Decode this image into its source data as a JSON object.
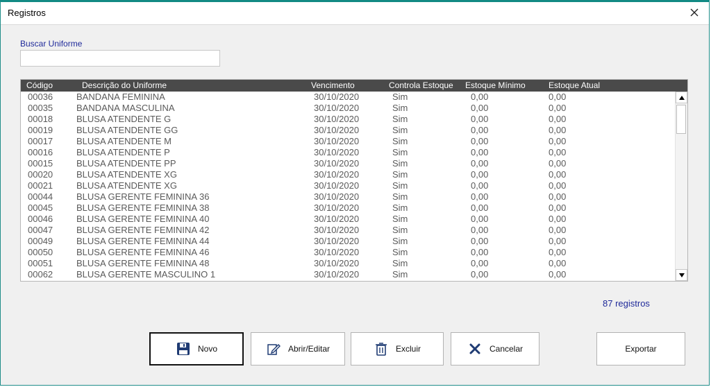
{
  "window": {
    "title": "Registros"
  },
  "search": {
    "label": "Buscar Uniforme",
    "value": "",
    "placeholder": ""
  },
  "table": {
    "headers": [
      "Código",
      "Descrição do Uniforme",
      "Vencimento",
      "Controla Estoque",
      "Estoque Mínimo",
      "Estoque Atual"
    ],
    "rows": [
      [
        "00036",
        "BANDANA FEMININA",
        "30/10/2020",
        "Sim",
        "0,00",
        "0,00"
      ],
      [
        "00035",
        "BANDANA MASCULINA",
        "30/10/2020",
        "Sim",
        "0,00",
        "0,00"
      ],
      [
        "00018",
        "BLUSA ATENDENTE G",
        "30/10/2020",
        "Sim",
        "0,00",
        "0,00"
      ],
      [
        "00019",
        "BLUSA ATENDENTE GG",
        "30/10/2020",
        "Sim",
        "0,00",
        "0,00"
      ],
      [
        "00017",
        "BLUSA ATENDENTE M",
        "30/10/2020",
        "Sim",
        "0,00",
        "0,00"
      ],
      [
        "00016",
        "BLUSA ATENDENTE P",
        "30/10/2020",
        "Sim",
        "0,00",
        "0,00"
      ],
      [
        "00015",
        "BLUSA ATENDENTE PP",
        "30/10/2020",
        "Sim",
        "0,00",
        "0,00"
      ],
      [
        "00020",
        "BLUSA ATENDENTE XG",
        "30/10/2020",
        "Sim",
        "0,00",
        "0,00"
      ],
      [
        "00021",
        "BLUSA ATENDENTE XG",
        "30/10/2020",
        "Sim",
        "0,00",
        "0,00"
      ],
      [
        "00044",
        "BLUSA GERENTE FEMININA 36",
        "30/10/2020",
        "Sim",
        "0,00",
        "0,00"
      ],
      [
        "00045",
        "BLUSA GERENTE FEMININA 38",
        "30/10/2020",
        "Sim",
        "0,00",
        "0,00"
      ],
      [
        "00046",
        "BLUSA GERENTE FEMININA 40",
        "30/10/2020",
        "Sim",
        "0,00",
        "0,00"
      ],
      [
        "00047",
        "BLUSA GERENTE FEMININA 42",
        "30/10/2020",
        "Sim",
        "0,00",
        "0,00"
      ],
      [
        "00049",
        "BLUSA GERENTE FEMININA 44",
        "30/10/2020",
        "Sim",
        "0,00",
        "0,00"
      ],
      [
        "00050",
        "BLUSA GERENTE FEMININA 46",
        "30/10/2020",
        "Sim",
        "0,00",
        "0,00"
      ],
      [
        "00051",
        "BLUSA GERENTE FEMININA 48",
        "30/10/2020",
        "Sim",
        "0,00",
        "0,00"
      ],
      [
        "00062",
        "BLUSA GERENTE MASCULINO 1",
        "30/10/2020",
        "Sim",
        "0,00",
        "0,00"
      ]
    ]
  },
  "status": {
    "count_text": "87 registros"
  },
  "buttons": {
    "novo": "Novo",
    "abrir": "Abrir/Editar",
    "excluir": "Excluir",
    "cancelar": "Cancelar",
    "exportar": "Exportar"
  },
  "icons": {
    "close": "close-icon",
    "save": "floppy-disk-icon",
    "edit": "pencil-edit-icon",
    "delete": "trash-icon",
    "cancel": "x-cancel-icon"
  },
  "colors": {
    "accent": "#128a84",
    "header_bg": "#4a4a4a",
    "label_blue": "#1f2a9a",
    "icon_navy": "#1f3b73"
  }
}
